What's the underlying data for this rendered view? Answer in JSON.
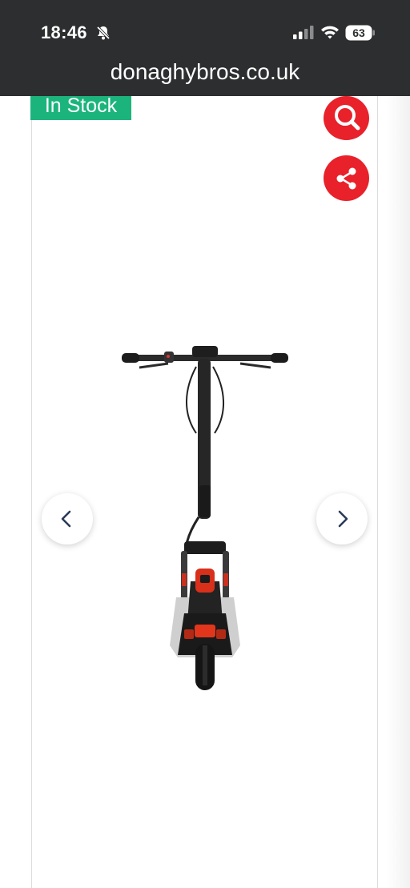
{
  "status_bar": {
    "time": "18:46",
    "battery": "63",
    "icons": [
      "bell-slash-icon",
      "signal-icon",
      "wifi-icon",
      "battery-icon"
    ]
  },
  "browser": {
    "url": "donaghybros.co.uk"
  },
  "product": {
    "stock_badge": "In Stock",
    "image": "electric-scooter-front-view"
  },
  "controls": {
    "search_icon": "search-icon",
    "share_icon": "share-icon",
    "prev_icon": "chevron-left-icon",
    "next_icon": "chevron-right-icon"
  },
  "colors": {
    "status_bg": "#2c2e2f",
    "badge": "#1bb47c",
    "accent": "#e8212b"
  }
}
